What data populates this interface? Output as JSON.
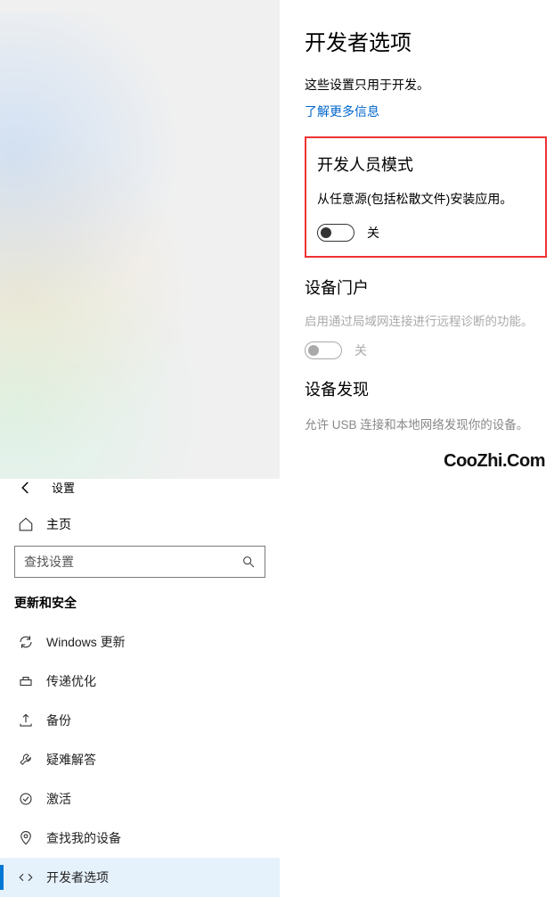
{
  "window": {
    "title": "设置"
  },
  "home_label": "主页",
  "search": {
    "placeholder": "查找设置"
  },
  "section_title": "更新和安全",
  "nav": [
    {
      "label": "Windows 更新"
    },
    {
      "label": "传递优化"
    },
    {
      "label": "备份"
    },
    {
      "label": "疑难解答"
    },
    {
      "label": "激活"
    },
    {
      "label": "查找我的设备"
    },
    {
      "label": "开发者选项"
    }
  ],
  "page": {
    "title": "开发者选项",
    "subtitle": "这些设置只用于开发。",
    "learn_more": "了解更多信息",
    "dev_mode": {
      "title": "开发人员模式",
      "desc": "从任意源(包括松散文件)安装应用。",
      "state_label": "关"
    },
    "device_portal": {
      "title": "设备门户",
      "desc": "启用通过局域网连接进行远程诊断的功能。",
      "state_label": "关"
    },
    "device_discovery": {
      "title": "设备发现",
      "desc": "允许 USB 连接和本地网络发现你的设备。"
    }
  },
  "watermark": "CooZhi.Com"
}
